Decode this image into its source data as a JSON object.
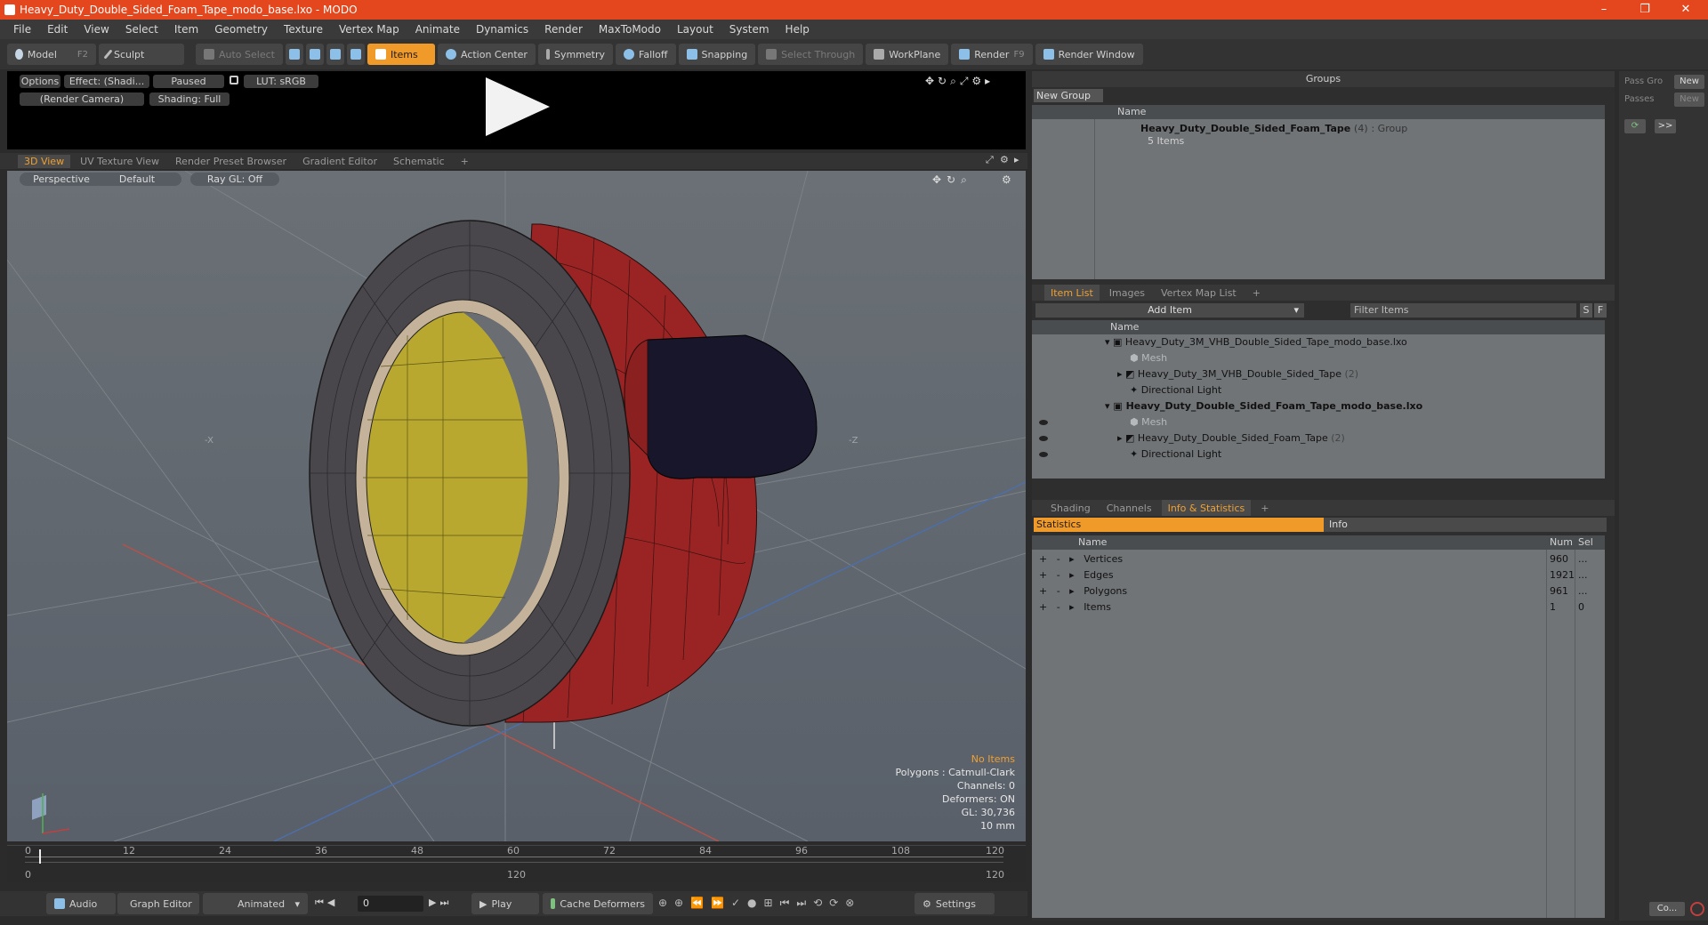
{
  "window": {
    "title": "Heavy_Duty_Double_Sided_Foam_Tape_modo_base.lxo - MODO",
    "minimize": "–",
    "restore": "❐",
    "close": "✕"
  },
  "menu": [
    "File",
    "Edit",
    "View",
    "Select",
    "Item",
    "Geometry",
    "Texture",
    "Vertex Map",
    "Animate",
    "Dynamics",
    "Render",
    "MaxToModo",
    "Layout",
    "System",
    "Help"
  ],
  "toolbar": {
    "model": "Model",
    "model_key": "F2",
    "sculpt": "Sculpt",
    "auto_select": "Auto Select",
    "items": "Items",
    "action_center": "Action Center",
    "symmetry": "Symmetry",
    "falloff": "Falloff",
    "snapping": "Snapping",
    "select_through": "Select Through",
    "workplane": "WorkPlane",
    "render": "Render",
    "render_key": "F9",
    "render_window": "Render Window"
  },
  "preview": {
    "options": "Options",
    "effect": "Effect: (Shadi...",
    "paused": "Paused",
    "lut": "LUT: sRGB",
    "camera": "(Render Camera)",
    "shading": "Shading: Full"
  },
  "viewtabs": [
    "3D View",
    "UV Texture View",
    "Render Preset Browser",
    "Gradient Editor",
    "Schematic",
    "+"
  ],
  "viewport": {
    "perspective": "Perspective",
    "default": "Default",
    "raygl": "Ray GL: Off",
    "axis_neg_x": "-X",
    "axis_neg_z": "-Z",
    "no_items": "No Items",
    "polygons": "Polygons : Catmull-Clark",
    "channels": "Channels: 0",
    "deformers": "Deformers: ON",
    "gl": "GL: 30,736",
    "units": "10 mm"
  },
  "timeline": {
    "ticks": [
      "0",
      "12",
      "24",
      "36",
      "48",
      "60",
      "72",
      "84",
      "96",
      "108",
      "120"
    ],
    "start": "0",
    "mid": "120",
    "end": "120"
  },
  "transport": {
    "audio": "Audio",
    "graph_editor": "Graph Editor",
    "animated": "Animated",
    "frame": "0",
    "play": "Play",
    "cache_deformers": "Cache Deformers",
    "settings": "Settings"
  },
  "groups": {
    "title": "Groups",
    "new_group": "New Group",
    "name_col": "Name",
    "row_name": "Heavy_Duty_Double_Sided_Foam_Tape",
    "row_count": "(4)",
    "row_type": ": Group",
    "row_items": "5 Items"
  },
  "itemlist": {
    "tabs": [
      "Item List",
      "Images",
      "Vertex Map List",
      "+"
    ],
    "add_item": "Add Item",
    "filter": "Filter Items",
    "s": "S",
    "f": "F",
    "name_col": "Name",
    "rows": [
      {
        "label": "Heavy_Duty_3M_VHB_Double_Sided_Tape_modo_base.lxo"
      },
      {
        "label": "Mesh"
      },
      {
        "label": "Heavy_Duty_3M_VHB_Double_Sided_Tape",
        "count": "(2)"
      },
      {
        "label": "Directional Light"
      },
      {
        "label": "Heavy_Duty_Double_Sided_Foam_Tape_modo_base.lxo"
      },
      {
        "label": "Mesh"
      },
      {
        "label": "Heavy_Duty_Double_Sided_Foam_Tape",
        "count": "(2)"
      },
      {
        "label": "Directional Light"
      }
    ]
  },
  "info": {
    "tabs": [
      "Shading",
      "Channels",
      "Info & Statistics",
      "+"
    ],
    "statistics": "Statistics",
    "info": "Info",
    "name_col": "Name",
    "num_col": "Num",
    "sel_col": "Sel",
    "rows": [
      {
        "name": "Vertices",
        "num": "960",
        "sel": "..."
      },
      {
        "name": "Edges",
        "num": "1921",
        "sel": "..."
      },
      {
        "name": "Polygons",
        "num": "961",
        "sel": "..."
      },
      {
        "name": "Items",
        "num": "1",
        "sel": "0"
      }
    ]
  },
  "far": {
    "pass_gro": "Pass Gro",
    "new1": "New",
    "passes": "Passes",
    "new2": "New",
    "more": ">>",
    "co": "Co..."
  }
}
